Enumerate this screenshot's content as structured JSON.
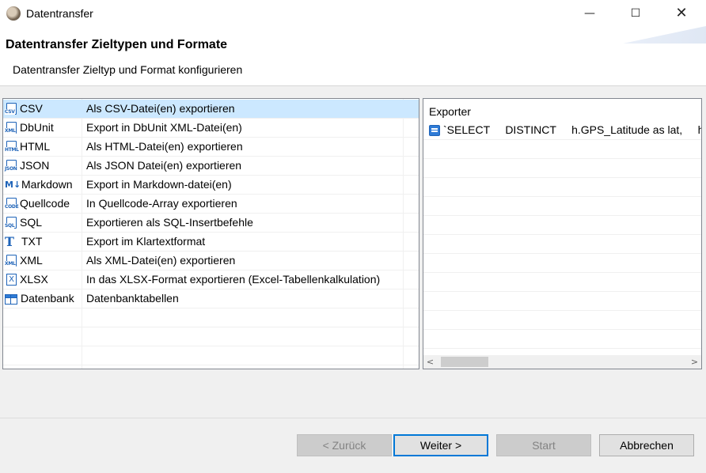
{
  "window": {
    "title": "Datentransfer",
    "minimize_glyph": "—",
    "maximize_glyph": "☐",
    "close_glyph": "✕"
  },
  "header": {
    "title": "Datentransfer Zieltypen und Formate",
    "subtitle": "Datentransfer Zieltyp und Format konfigurieren"
  },
  "formats": [
    {
      "name": "CSV",
      "description": "Als CSV-Datei(en) exportieren",
      "icon": "csv-file-icon",
      "icon_tag": "CSV",
      "selected": true
    },
    {
      "name": "DbUnit",
      "description": "Export in DbUnit XML-Datei(en)",
      "icon": "dbunit-file-icon",
      "icon_tag": "XML",
      "selected": false
    },
    {
      "name": "HTML",
      "description": "Als HTML-Datei(en) exportieren",
      "icon": "html-file-icon",
      "icon_tag": "HTML",
      "selected": false
    },
    {
      "name": "JSON",
      "description": "Als JSON Datei(en) exportieren",
      "icon": "json-file-icon",
      "icon_tag": "JSON",
      "selected": false
    },
    {
      "name": "Markdown",
      "description": "Export in Markdown-datei(en)",
      "icon": "markdown-icon",
      "icon_tag": "M↓",
      "selected": false
    },
    {
      "name": "Quellcode",
      "description": "In Quellcode-Array exportieren",
      "icon": "source-code-file-icon",
      "icon_tag": "CODE",
      "selected": false
    },
    {
      "name": "SQL",
      "description": "Exportieren als SQL-Insertbefehle",
      "icon": "sql-file-icon",
      "icon_tag": "SQL",
      "selected": false
    },
    {
      "name": "TXT",
      "description": "Export im Klartextformat",
      "icon": "text-format-icon",
      "icon_tag": "T",
      "selected": false
    },
    {
      "name": "XML",
      "description": "Als XML-Datei(en) exportieren",
      "icon": "xml-file-icon",
      "icon_tag": "XML",
      "selected": false
    },
    {
      "name": "XLSX",
      "description": "In das XLSX-Format exportieren (Excel-Tabellenkalkulation)",
      "icon": "xlsx-file-icon",
      "icon_tag": "X",
      "selected": false
    },
    {
      "name": "Datenbank",
      "description": "Datenbanktabellen",
      "icon": "database-table-icon",
      "icon_tag": "",
      "selected": false
    }
  ],
  "exporter": {
    "header": "Exporter",
    "item": "`SELECT     DISTINCT     h.GPS_Latitude as lat,     h.GPS"
  },
  "buttons": {
    "back": "< Zurück",
    "next": "Weiter >",
    "start": "Start",
    "cancel": "Abbrechen"
  }
}
